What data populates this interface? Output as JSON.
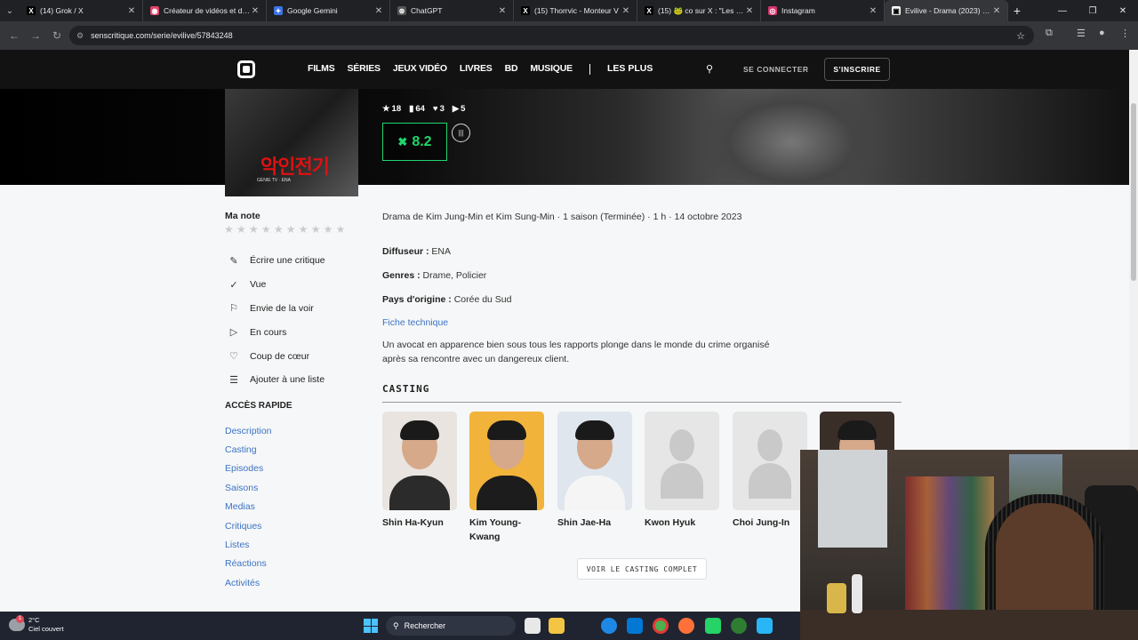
{
  "browser": {
    "tabs": [
      {
        "title": "(14) Grok / X",
        "icon": "x-icon",
        "color": "#000000",
        "glyph": "X"
      },
      {
        "title": "Créateur de vidéos et d'ima",
        "icon": "app-icon",
        "color": "#e2436a",
        "glyph": "◉"
      },
      {
        "title": "Google Gemini",
        "icon": "gemini-icon",
        "color": "#3b73e8",
        "glyph": "✦"
      },
      {
        "title": "ChatGPT",
        "icon": "chatgpt-icon",
        "color": "#555555",
        "glyph": "⊛"
      },
      {
        "title": "(15) Thorrvic - Monteur V",
        "icon": "x-icon",
        "color": "#000000",
        "glyph": "X"
      },
      {
        "title": "(15) 🐸 co sur X : \"Les tra",
        "icon": "x-icon",
        "color": "#000000",
        "glyph": "X"
      },
      {
        "title": "Instagram",
        "icon": "instagram-icon",
        "color": "#d6336c",
        "glyph": "◎"
      },
      {
        "title": "Evilive - Drama (2023) - S",
        "icon": "senscritique-icon",
        "color": "#ffffff",
        "glyph": "▣"
      }
    ],
    "url": "senscritique.com/serie/evilive/57843248"
  },
  "site": {
    "nav": [
      "FILMS",
      "SÉRIES",
      "JEUX VIDÉO",
      "LIVRES",
      "BD",
      "MUSIQUE"
    ],
    "les_plus": "LES PLUS",
    "connect": "SE CONNECTER",
    "signup": "S'INSCRIRE"
  },
  "hero": {
    "stats": [
      {
        "icon": "star-icon",
        "glyph": "★",
        "value": "18"
      },
      {
        "icon": "bookmark-icon",
        "glyph": "▮",
        "value": "64"
      },
      {
        "icon": "heart-icon",
        "glyph": "♥",
        "value": "3"
      },
      {
        "icon": "play-icon",
        "glyph": "▶",
        "value": "5"
      }
    ],
    "score": "8.2",
    "poster_title": "악인전기"
  },
  "sidebar": {
    "ma_note": "Ma note",
    "actions": [
      {
        "icon": "pencil-icon",
        "glyph": "✎",
        "label": "Écrire une critique"
      },
      {
        "icon": "check-icon",
        "glyph": "✓",
        "label": "Vue"
      },
      {
        "icon": "bookmark-icon",
        "glyph": "⚐",
        "label": "Envie de la voir"
      },
      {
        "icon": "play-icon",
        "glyph": "▷",
        "label": "En cours"
      },
      {
        "icon": "heart-icon",
        "glyph": "♡",
        "label": "Coup de cœur"
      },
      {
        "icon": "list-icon",
        "glyph": "☰",
        "label": "Ajouter à une liste"
      }
    ],
    "acces_rapide": "ACCÈS RAPIDE",
    "quick_links": [
      "Description",
      "Casting",
      "Episodes",
      "Saisons",
      "Medias",
      "Critiques",
      "Listes",
      "Réactions",
      "Activités"
    ]
  },
  "main": {
    "meta": "Drama de Kim Jung-Min et Kim Sung-Min · 1 saison (Terminée) · 1 h · 14 octobre 2023",
    "diffuseur_label": "Diffuseur :",
    "diffuseur": "ENA",
    "genres_label": "Genres :",
    "genres": "Drame, Policier",
    "pays_label": "Pays d'origine :",
    "pays": "Corée du Sud",
    "fiche": "Fiche technique",
    "synopsis": "Un avocat en apparence bien sous tous les rapports plonge dans le monde du crime organisé après sa rencontre avec un dangereux client.",
    "casting_title": "CASTING",
    "cast": [
      "Shin Ha-Kyun",
      "Kim Young-Kwang",
      "Shin Jae-Ha",
      "Kwon Hyuk",
      "Choi Jung-In"
    ],
    "voir_casting": "VOIR LE CASTING COMPLET"
  },
  "taskbar": {
    "temp": "2°C",
    "weather": "Ciel couvert",
    "badge": "1",
    "search": "Rechercher"
  }
}
